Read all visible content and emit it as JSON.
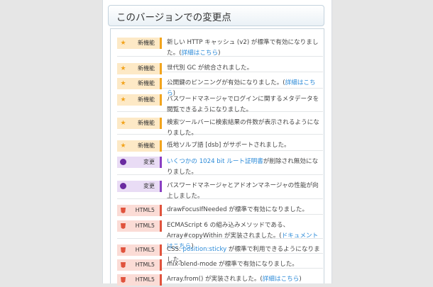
{
  "header": {
    "title": "このバージョンでの変更点"
  },
  "badges": {
    "new": "新機能",
    "change": "変更",
    "html5": "HTML5"
  },
  "rows": [
    {
      "type": "new",
      "text": "新しい HTTP キャッシュ (v2) が標準で有効になりました。(",
      "link": "詳細はこちら",
      "after": ")"
    },
    {
      "type": "new",
      "text": "世代別 GC が統合されました。",
      "link": "",
      "after": ""
    },
    {
      "type": "new",
      "text": "公開鍵のピンニングが有効になりました。(",
      "link": "詳細はこちら",
      "after": ")"
    },
    {
      "type": "new",
      "text": "パスワードマネージャでログインに関するメタデータを閲覧できるようになりました。",
      "link": "",
      "after": ""
    },
    {
      "type": "new",
      "text": "検索ツールバーに検索結果の件数が表示されるようになりました。",
      "link": "",
      "after": ""
    },
    {
      "type": "new",
      "text": "低地ソルブ語 [dsb] がサポートされました。",
      "link": "",
      "after": ""
    },
    {
      "type": "change",
      "text": "",
      "link": "いくつかの 1024 bit ルート証明書",
      "after": "が削除され無効になりました。"
    },
    {
      "type": "change",
      "text": "パスワードマネージャとアドオンマネージャの性能が向上しました。",
      "link": "",
      "after": ""
    },
    {
      "type": "html5",
      "text": "drawFocusIfNeeded が標準で有効になりました。",
      "link": "",
      "after": ""
    },
    {
      "type": "html5",
      "text": "ECMAScript 6 の組み込みメソッドである、Array#copyWithin が実装されました。(",
      "link": "ドキュメントはこちら",
      "after": ")"
    },
    {
      "type": "html5",
      "text": "CSS: ",
      "link": "position:sticky",
      "after": " が標準で利用できるようになりました。"
    },
    {
      "type": "html5",
      "text": "mix-blend-mode が標準で有効になりました。",
      "link": "",
      "after": ""
    },
    {
      "type": "html5",
      "text": "Array.from() が実装されました。(",
      "link": "詳細はこちら",
      "after": ")"
    }
  ]
}
